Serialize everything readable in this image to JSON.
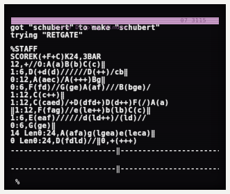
{
  "window": {
    "title_left": "Score Display Window",
    "title_right": "07 3115"
  },
  "terminal": {
    "lines": [
      "got \"schubert\" to make \"schubert\"",
      "trying \"RETGATE\"",
      "",
      "%STAFF",
      "SCOREK(+F+C)K24,3BAR",
      "12,+//O:A(a)B(b)C(c)‖",
      "1:6,D(+d(d)//////D(++)/cb‖",
      "0:12,A(aec)/A(+++)Bg‖",
      "0:6,F(fd)//G(ge)A(af)///B(bge)/",
      "1:12,C(c++)‖",
      "1:12,C(caed)/+D(dfd+)D(d++)F(/)A(a)",
      "‖1:12,F(fag)//e(le++)b(lb)C(c)‖",
      "1:6,E(eaf)//////d(ld++)/(ld)//",
      "0:6,G(ge)‖",
      "14 Len0:24,A(afa)g(lgea)e(leca)‖",
      "0 Len0:24,D(fdld)//‖0,+(+++)"
    ],
    "ruler_top": "------------------------‖------------------------",
    "ruler_bottom": "------------------------‖------------------------",
    "prompt": "%"
  }
}
